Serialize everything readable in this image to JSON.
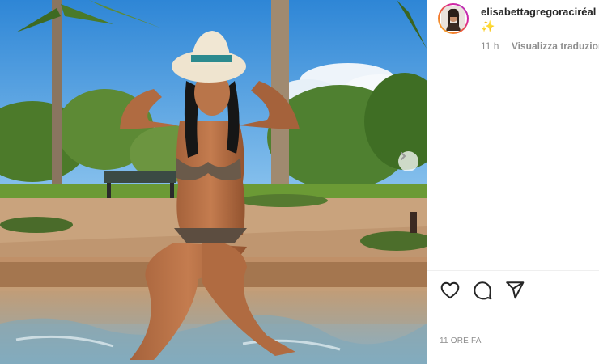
{
  "post": {
    "username": "elisabettagregoraciréal",
    "caption_emoji": "✨",
    "time_short": "11 h",
    "translate_label": "Visualizza traduzione",
    "time_long": "11 ORE FA"
  },
  "icons": {
    "like": "heart-icon",
    "comment": "comment-icon",
    "share": "paper-plane-icon",
    "next": "chevron-right-icon"
  },
  "colors": {
    "username_text": "#262626",
    "secondary_text": "#8e8e8e",
    "divider": "#efefef"
  }
}
